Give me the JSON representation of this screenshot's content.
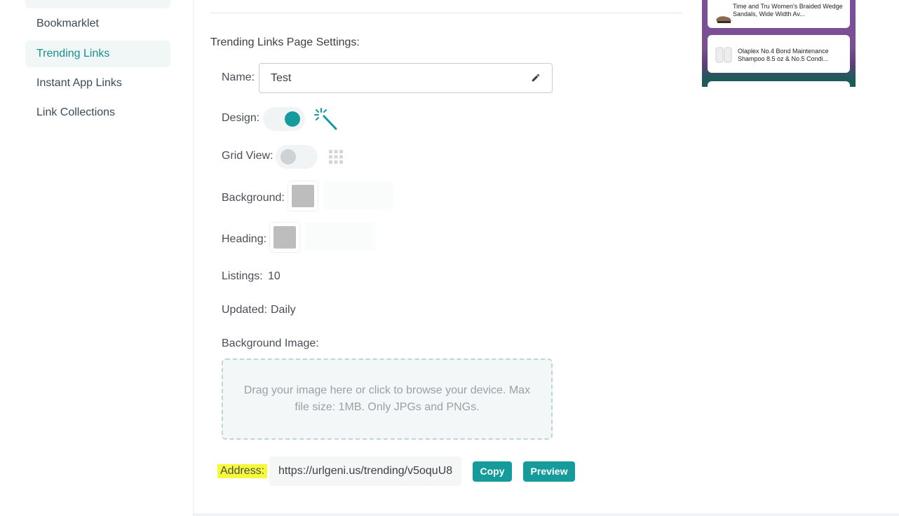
{
  "sidebar": {
    "items": [
      {
        "label": "Bookmarklet",
        "active": false
      },
      {
        "label": "Trending Links",
        "active": true
      },
      {
        "label": "Instant App Links",
        "active": false
      },
      {
        "label": "Link Collections",
        "active": false
      }
    ]
  },
  "settings": {
    "title": "Trending Links Page Settings:",
    "name_label": "Name:",
    "name_value": "Test",
    "design_label": "Design:",
    "design_on": true,
    "grid_label": "Grid View:",
    "grid_on": false,
    "background_label": "Background:",
    "heading_label": "Heading:",
    "listings_label": "Listings:",
    "listings_value": "10",
    "updated_label": "Updated:",
    "updated_value": "Daily",
    "bg_image_label": "Background Image:",
    "dropzone_text": "Drag your image here or click to browse your device. Max file size: 1MB. Only JPGs and PNGs.",
    "address_label": "Address:",
    "address_value": "https://urlgeni.us/trending/v5oquU8",
    "copy_label": "Copy",
    "preview_label": "Preview"
  },
  "preview": {
    "cards": [
      {
        "title": "Time and Tru Women's Braided Wedge Sandals, Wide Width Av..."
      },
      {
        "title": "Olaplex No.4 Bond Maintenance Shampoo 8.5 oz & No.5 Condi..."
      }
    ]
  },
  "colors": {
    "accent": "#159b9b",
    "highlight": "#f6f93a",
    "swatch": "#bdbdbd"
  },
  "icons": {
    "design": "magic-wand-icon",
    "grid": "grid-icon",
    "edit": "pencil-icon"
  }
}
